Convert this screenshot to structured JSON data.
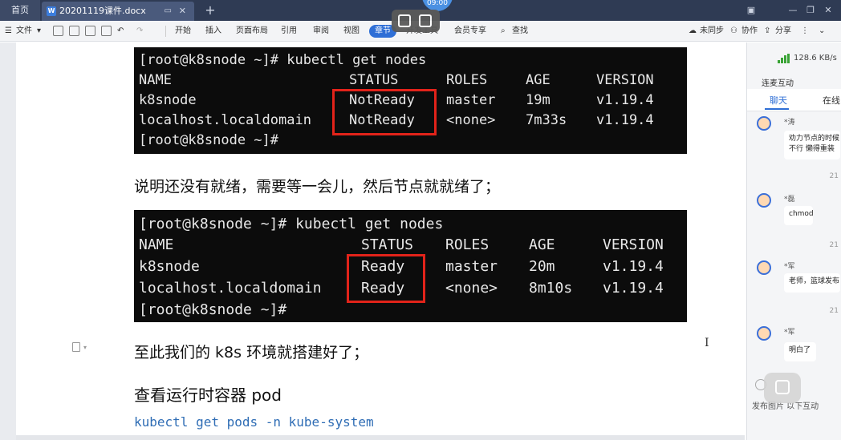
{
  "tabbar": {
    "home_label": "首页",
    "doc_tab_label": "20201119课件.docx",
    "doc_icon_letter": "W",
    "add_tab": "+",
    "time_badge": "09:00"
  },
  "window_controls": {
    "minimize": "—",
    "maximize": "❐",
    "close": "✕"
  },
  "menubar": {
    "file_label": "文件",
    "items": [
      "开始",
      "插入",
      "页面布局",
      "引用",
      "审阅",
      "视图",
      "章节",
      "开发工具",
      "会员专享"
    ],
    "active_item": "章节",
    "search_label": "查找",
    "unsynced_label": "未同步",
    "collab_label": "协作",
    "share_label": "分享"
  },
  "terminal1": {
    "prompt_line": "[root@k8snode ~]# kubectl get nodes",
    "headers": [
      "NAME",
      "STATUS",
      "ROLES",
      "AGE",
      "VERSION"
    ],
    "rows": [
      [
        "k8snode",
        "NotReady",
        "master",
        "19m",
        "v1.19.4"
      ],
      [
        "localhost.localdomain",
        "NotReady",
        "<none>",
        "7m33s",
        "v1.19.4"
      ]
    ],
    "end_prompt": "[root@k8snode ~]#"
  },
  "para1": "说明还没有就绪，需要等一会儿，然后节点就就绪了；",
  "terminal2": {
    "prompt_line": "[root@k8snode ~]# kubectl get nodes",
    "headers": [
      "NAME",
      "STATUS",
      "ROLES",
      "AGE",
      "VERSION"
    ],
    "rows": [
      [
        "k8snode",
        "Ready",
        "master",
        "20m",
        "v1.19.4"
      ],
      [
        "localhost.localdomain",
        "Ready",
        "<none>",
        "8m10s",
        "v1.19.4"
      ]
    ],
    "end_prompt": "[root@k8snode ~]#"
  },
  "para2": "至此我们的 k8s 环境就搭建好了；",
  "heading": "查看运行时容器 pod",
  "code": "kubectl get pods -n kube-system",
  "right_panel": {
    "speed": "128.6 KB/s",
    "title": "连麦互动",
    "tabs": [
      "聊天",
      "在线"
    ],
    "messages": [
      {
        "name": "*涛",
        "text_lines": [
          "劝力节点的时候",
          "不行 懒得重装"
        ],
        "time": "21"
      },
      {
        "name": "*磊",
        "text_lines": [
          "chmod"
        ],
        "time": "21"
      },
      {
        "name": "*军",
        "text_lines": [
          "老师，篮球发布"
        ],
        "time": "21"
      },
      {
        "name": "*军",
        "text_lines": [
          "明白了"
        ],
        "time": ""
      }
    ],
    "footer": "发布图片 以下互动"
  },
  "colors": {
    "accent": "#2f6fd6",
    "highlight_box": "#e2231a",
    "terminal_bg": "#0c0c0c",
    "code_text": "#2f6db5"
  }
}
